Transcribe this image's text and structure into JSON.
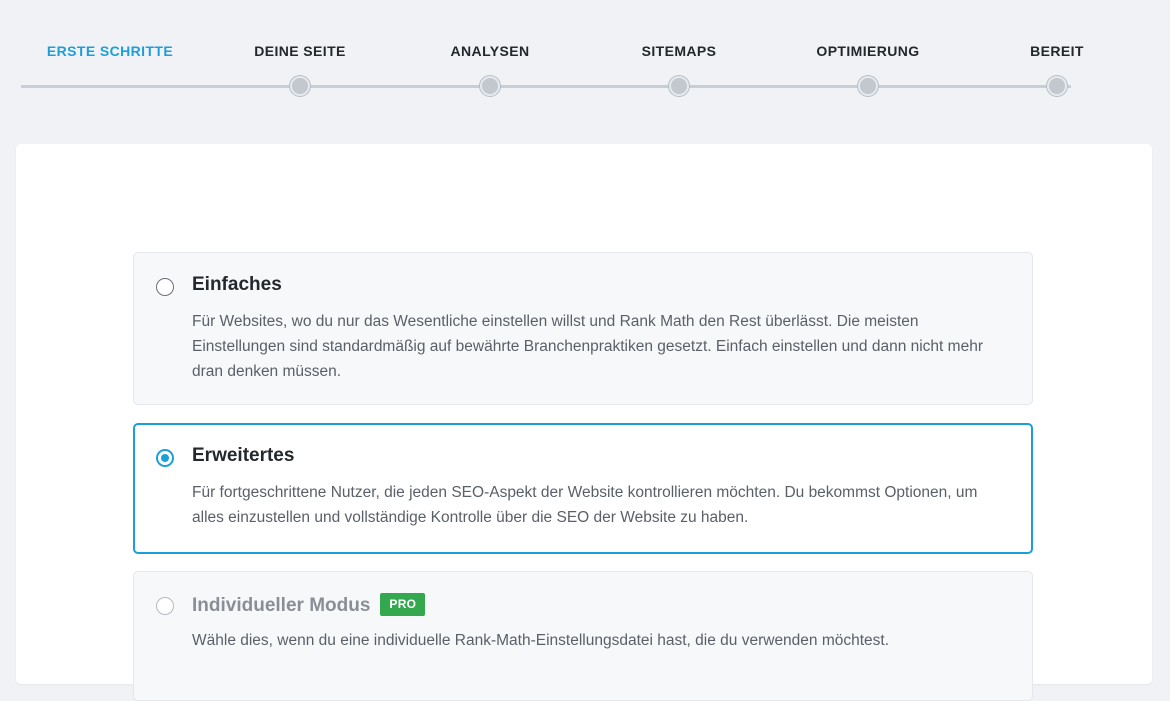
{
  "stepper": {
    "steps": [
      {
        "label": "ERSTE SCHRITTE",
        "active": true
      },
      {
        "label": "DEINE SEITE",
        "active": false
      },
      {
        "label": "ANALYSEN",
        "active": false
      },
      {
        "label": "SITEMAPS",
        "active": false
      },
      {
        "label": "OPTIMIERUNG",
        "active": false
      },
      {
        "label": "BEREIT",
        "active": false
      }
    ]
  },
  "modes": {
    "options": [
      {
        "title": "Einfaches",
        "description": "Für Websites, wo du nur das Wesentliche einstellen willst und Rank Math den Rest überlässt. Die meisten Einstellungen sind standardmäßig auf bewährte Branchenpraktiken gesetzt. Einfach einstellen und dann nicht mehr dran denken müssen.",
        "selected": false
      },
      {
        "title": "Erweitertes",
        "description": "Für fortgeschrittene Nutzer, die jeden SEO-Aspekt der Website kontrollieren möchten. Du bekommst Optionen, um alles einzustellen und vollständige Kontrolle über die SEO der Website zu haben.",
        "selected": true
      },
      {
        "title": "Individueller Modus",
        "badge": "PRO",
        "description": "Wähle dies, wenn du eine individuelle Rank-Math-Einstellungsdatei hast, die du verwenden möchtest.",
        "selected": false,
        "disabled": true
      }
    ]
  },
  "colors": {
    "accent": "#1c9fd8",
    "pro_badge": "#33a84f",
    "background": "#f0f2f5"
  }
}
